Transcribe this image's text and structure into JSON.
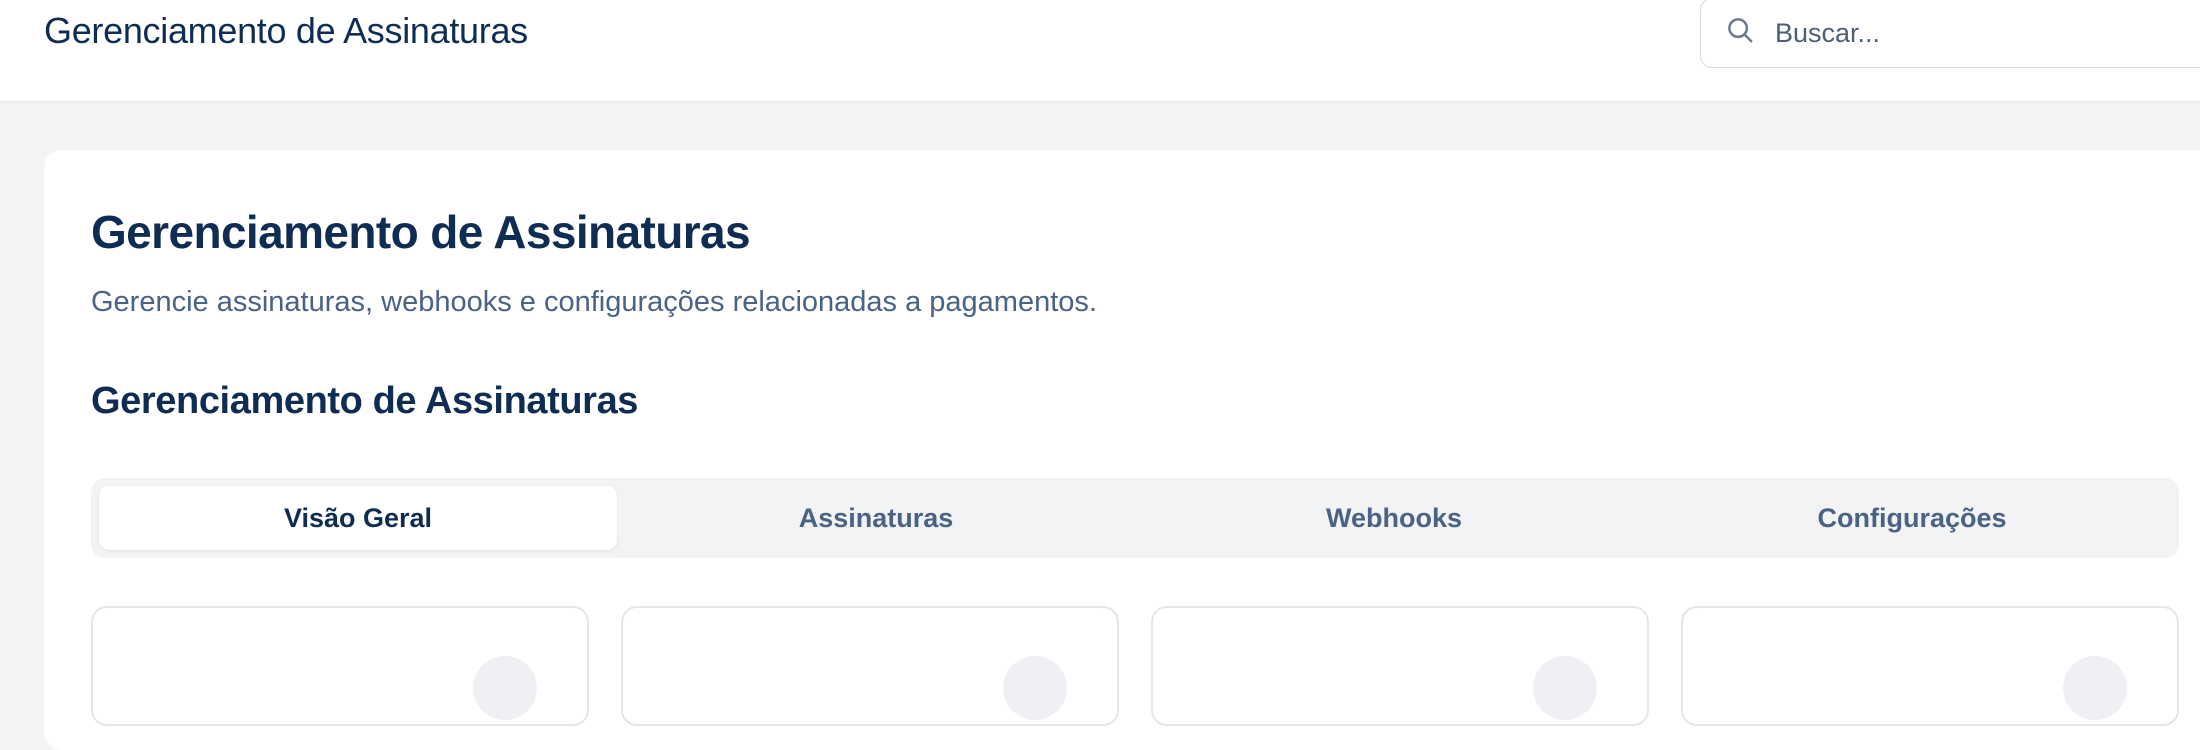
{
  "header": {
    "title": "Gerenciamento de Assinaturas"
  },
  "search": {
    "placeholder": "Buscar...",
    "value": "",
    "icon": "search-icon"
  },
  "main": {
    "title": "Gerenciamento de Assinaturas",
    "subtitle": "Gerencie assinaturas, webhooks e configurações relacionadas a pagamentos.",
    "section_title": "Gerenciamento de Assinaturas",
    "tabs": [
      {
        "label": "Visão Geral",
        "active": true
      },
      {
        "label": "Assinaturas",
        "active": false
      },
      {
        "label": "Webhooks",
        "active": false
      },
      {
        "label": "Configurações",
        "active": false
      }
    ]
  },
  "colors": {
    "primary_text": "#0f2d52",
    "secondary_text": "#4a6283",
    "background": "#f3f4f6",
    "tab_track": "#f1f3f5"
  }
}
